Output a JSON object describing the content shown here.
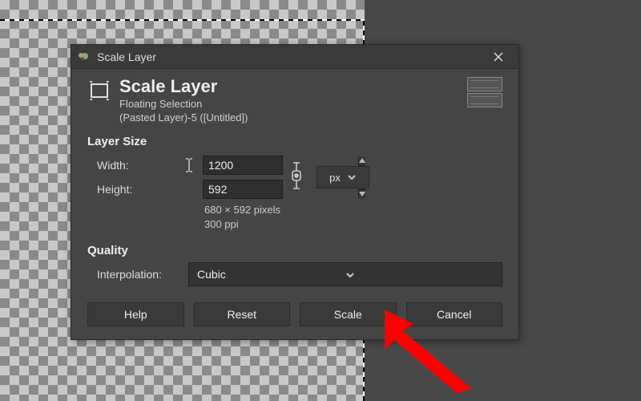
{
  "window": {
    "title": "Scale Layer"
  },
  "header": {
    "title": "Scale Layer",
    "sub1": "Floating Selection",
    "sub2": "(Pasted Layer)-5 ([Untitled])"
  },
  "layer_size": {
    "section_label": "Layer Size",
    "width_label": "Width:",
    "height_label": "Height:",
    "width_value": "1200",
    "height_value": "592",
    "unit": "px",
    "stat1": "680 × 592 pixels",
    "stat2": "300 ppi"
  },
  "quality": {
    "section_label": "Quality",
    "interp_label": "Interpolation:",
    "interp_value": "Cubic"
  },
  "buttons": {
    "help": "Help",
    "reset": "Reset",
    "scale": "Scale",
    "cancel": "Cancel"
  }
}
